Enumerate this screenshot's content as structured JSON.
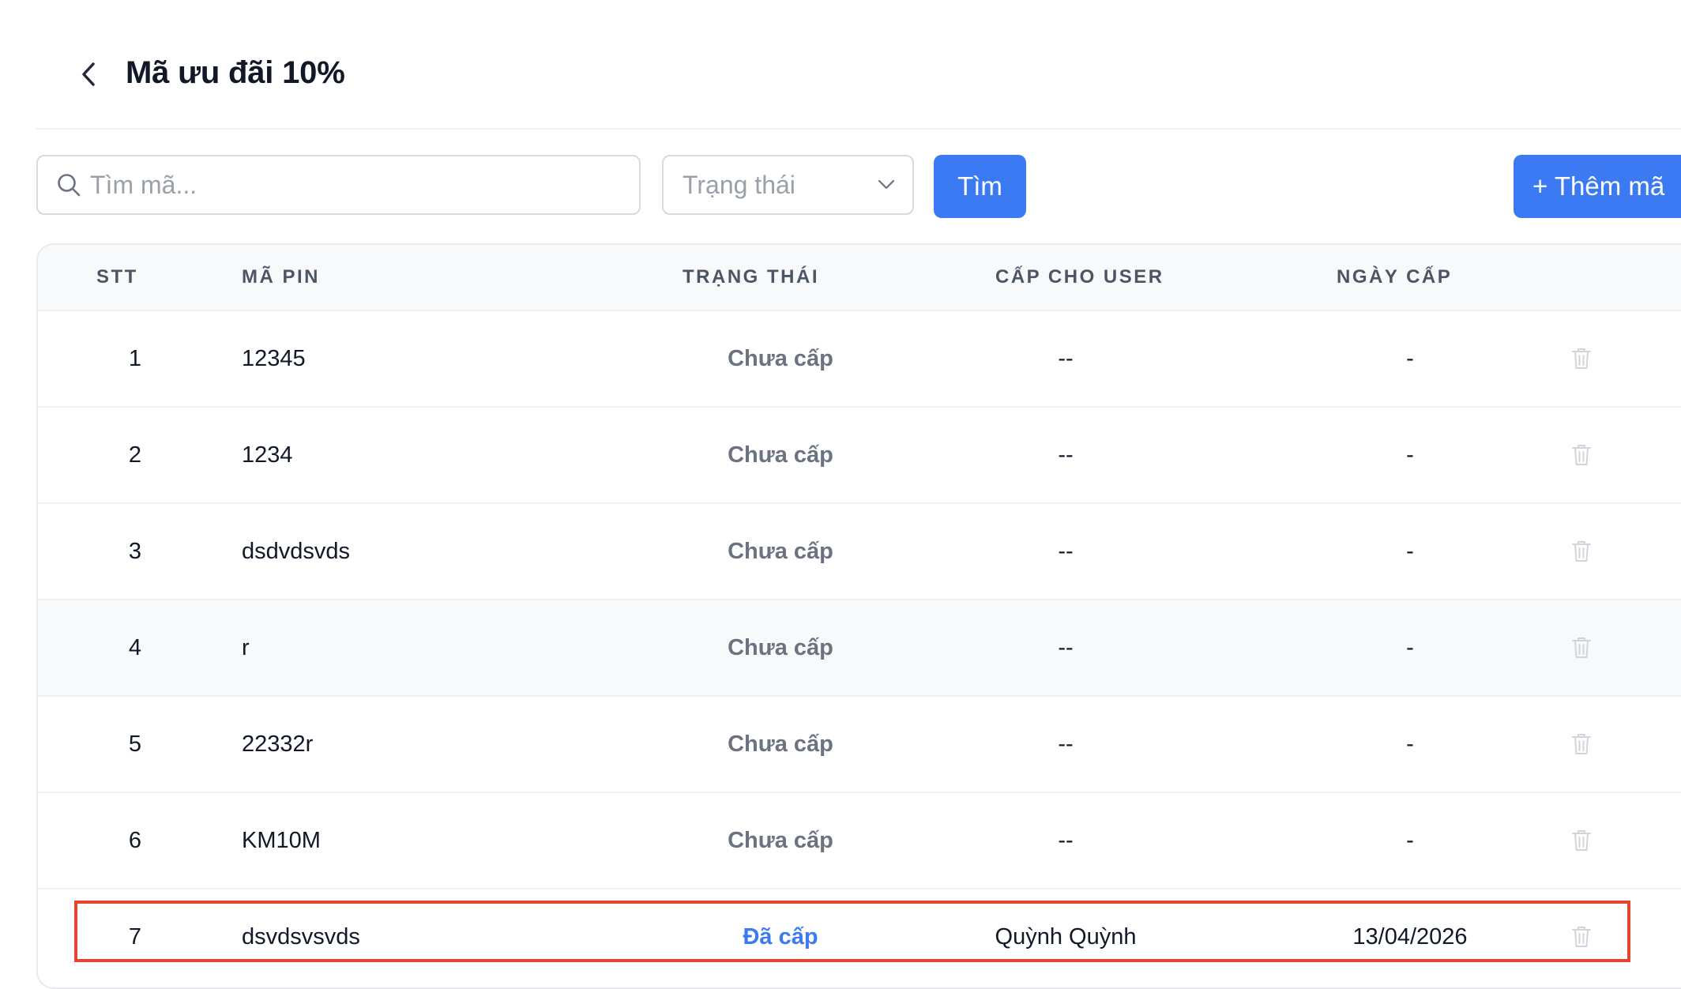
{
  "header": {
    "title": "Mã ưu đãi 10%"
  },
  "toolbar": {
    "search_placeholder": "Tìm mã...",
    "status_placeholder": "Trạng thái",
    "search_button": "Tìm",
    "add_button": "+ Thêm mã"
  },
  "table": {
    "columns": {
      "stt": "STT",
      "pin": "MÃ PIN",
      "status": "TRẠNG THÁI",
      "user": "CẤP CHO USER",
      "date": "NGÀY CẤP"
    },
    "rows": [
      {
        "stt": "1",
        "pin": "12345",
        "status": "Chưa cấp",
        "user": "--",
        "date": "-"
      },
      {
        "stt": "2",
        "pin": "1234",
        "status": "Chưa cấp",
        "user": "--",
        "date": "-"
      },
      {
        "stt": "3",
        "pin": "dsdvdsvds",
        "status": "Chưa cấp",
        "user": "--",
        "date": "-"
      },
      {
        "stt": "4",
        "pin": "r",
        "status": "Chưa cấp",
        "user": "--",
        "date": "-"
      },
      {
        "stt": "5",
        "pin": "22332r",
        "status": "Chưa cấp",
        "user": "--",
        "date": "-"
      },
      {
        "stt": "6",
        "pin": "KM10M",
        "status": "Chưa cấp",
        "user": "--",
        "date": "-"
      },
      {
        "stt": "7",
        "pin": "dsvdsvsvds",
        "status": "Đã cấp",
        "user": "Quỳnh Quỳnh",
        "date": "13/04/2026"
      }
    ]
  },
  "icons": {
    "back": "chevron-left-icon",
    "search": "search-icon",
    "dropdown": "chevron-down-icon",
    "delete": "trash-icon"
  },
  "colors": {
    "primary": "#3b7af2",
    "highlight": "#e5462f",
    "muted": "#6b7280"
  }
}
